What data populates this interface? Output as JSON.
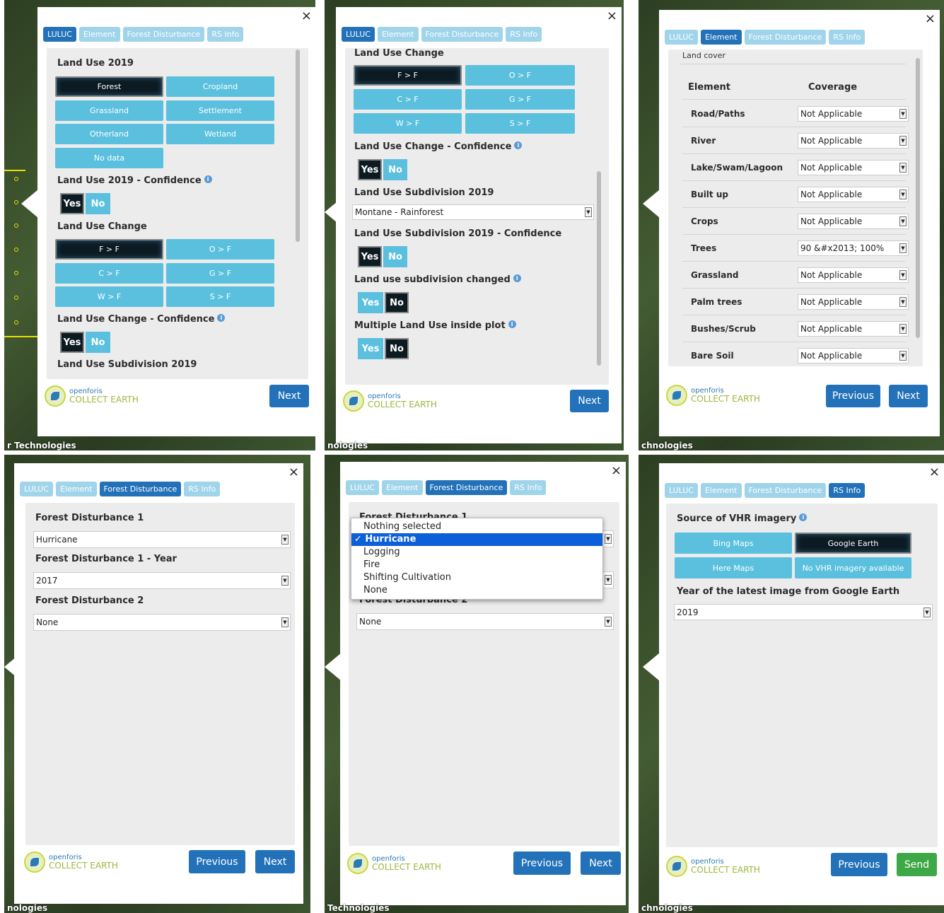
{
  "attribution": "Technologies",
  "attrib_1": "r Technologies",
  "attrib_2": "nologies",
  "attrib_3": "chnologies",
  "attrib_4": "nologies",
  "attrib_5": "Technologies",
  "attrib_6": "chnologies",
  "tabs": [
    "LULUC",
    "Element",
    "Forest Disturbance",
    "RS Info"
  ],
  "close": "×",
  "logo": {
    "line1": "openforis",
    "line2": "COLLECT EARTH"
  },
  "buttons": {
    "next": "Next",
    "previous": "Previous",
    "send": "Send"
  },
  "yes": "Yes",
  "no": "No",
  "panel1": {
    "land_use_title": "Land Use 2019",
    "land_use_options": [
      "Forest",
      "Cropland",
      "Grassland",
      "Settlement",
      "Otherland",
      "Wetland",
      "No data"
    ],
    "land_use_conf": "Land Use 2019 - Confidence",
    "change_title": "Land Use Change",
    "change_options": [
      "F > F",
      "O > F",
      "C > F",
      "G > F",
      "W > F",
      "S > F"
    ],
    "change_conf": "Land Use Change - Confidence",
    "cut_text": "Land Use Subdivision 2019"
  },
  "panel2": {
    "change_title": "Land Use Change",
    "change_conf": "Land Use Change - Confidence",
    "subdivision": "Land Use Subdivision 2019",
    "subdivision_value": "Montane - Rainforest",
    "subdivision_conf": "Land Use Subdivision 2019 - Confidence",
    "sub_changed": "Land use subdivision changed",
    "multiple": "Multiple Land Use inside plot"
  },
  "panel3": {
    "section": "Land cover",
    "col_element": "Element",
    "col_coverage": "Coverage",
    "rows": [
      {
        "name": "Road/Paths",
        "value": "Not Applicable"
      },
      {
        "name": "River",
        "value": "Not Applicable"
      },
      {
        "name": "Lake/Swam/Lagoon",
        "value": "Not Applicable"
      },
      {
        "name": "Built up",
        "value": "Not Applicable"
      },
      {
        "name": "Crops",
        "value": "Not Applicable"
      },
      {
        "name": "Trees",
        "value": "90 &#x2013; 100%"
      },
      {
        "name": "Grassland",
        "value": "Not Applicable"
      },
      {
        "name": "Palm trees",
        "value": "Not Applicable"
      },
      {
        "name": "Bushes/Scrub",
        "value": "Not Applicable"
      },
      {
        "name": "Bare Soil",
        "value": "Not Applicable"
      }
    ]
  },
  "panel4": {
    "fd1": "Forest Disturbance 1",
    "fd1_value": "Hurricane",
    "fd1_year": "Forest Disturbance 1 - Year",
    "fd1_year_value": "2017",
    "fd2": "Forest Disturbance 2",
    "fd2_value": "None"
  },
  "panel5": {
    "fd1": "Forest Disturbance 1",
    "fd2": "Forest Disturbance 2",
    "fd2_value": "None",
    "options": [
      "Nothing selected",
      "✓ Hurricane",
      "Logging",
      "Fire",
      "Shifting Cultivation",
      "None"
    ]
  },
  "panel6": {
    "source": "Source of VHR imagery",
    "options": [
      "Bing Maps",
      "Google Earth",
      "Here Maps",
      "No VHR imagery available"
    ],
    "year_label": "Year of the latest image from Google Earth",
    "year_value": "2019"
  }
}
